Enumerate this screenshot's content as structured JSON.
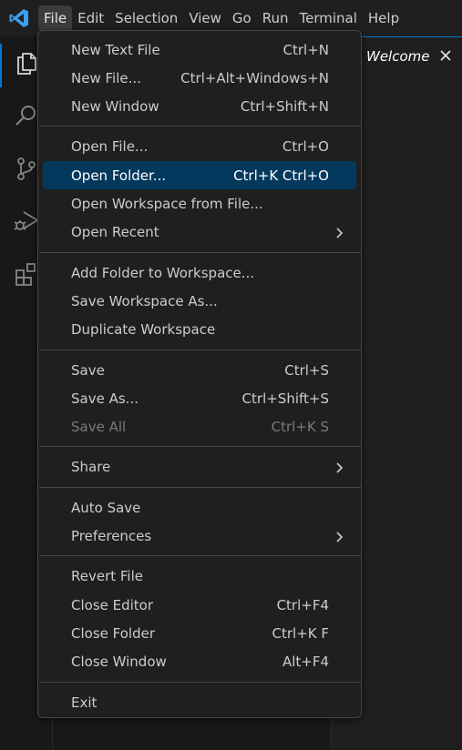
{
  "menubar": {
    "items": [
      {
        "label": "File",
        "active": true
      },
      {
        "label": "Edit"
      },
      {
        "label": "Selection"
      },
      {
        "label": "View"
      },
      {
        "label": "Go"
      },
      {
        "label": "Run"
      },
      {
        "label": "Terminal"
      },
      {
        "label": "Help"
      }
    ]
  },
  "activitybar": {
    "icons": [
      "explorer-icon",
      "search-icon",
      "source-control-icon",
      "run-debug-icon",
      "extensions-icon"
    ]
  },
  "editor": {
    "tab_label": "Welcome"
  },
  "file_menu": {
    "groups": [
      [
        {
          "label": "New Text File",
          "shortcut": "Ctrl+N"
        },
        {
          "label": "New File...",
          "shortcut": "Ctrl+Alt+Windows+N"
        },
        {
          "label": "New Window",
          "shortcut": "Ctrl+Shift+N"
        }
      ],
      [
        {
          "label": "Open File...",
          "shortcut": "Ctrl+O"
        },
        {
          "label": "Open Folder...",
          "shortcut": "Ctrl+K Ctrl+O",
          "highlight": true
        },
        {
          "label": "Open Workspace from File...",
          "shortcut": ""
        },
        {
          "label": "Open Recent",
          "shortcut": "",
          "submenu": true
        }
      ],
      [
        {
          "label": "Add Folder to Workspace...",
          "shortcut": ""
        },
        {
          "label": "Save Workspace As...",
          "shortcut": ""
        },
        {
          "label": "Duplicate Workspace",
          "shortcut": ""
        }
      ],
      [
        {
          "label": "Save",
          "shortcut": "Ctrl+S"
        },
        {
          "label": "Save As...",
          "shortcut": "Ctrl+Shift+S"
        },
        {
          "label": "Save All",
          "shortcut": "Ctrl+K S",
          "disabled": true
        }
      ],
      [
        {
          "label": "Share",
          "shortcut": "",
          "submenu": true
        }
      ],
      [
        {
          "label": "Auto Save",
          "shortcut": ""
        },
        {
          "label": "Preferences",
          "shortcut": "",
          "submenu": true
        }
      ],
      [
        {
          "label": "Revert File",
          "shortcut": ""
        },
        {
          "label": "Close Editor",
          "shortcut": "Ctrl+F4"
        },
        {
          "label": "Close Folder",
          "shortcut": "Ctrl+K F"
        },
        {
          "label": "Close Window",
          "shortcut": "Alt+F4"
        }
      ],
      [
        {
          "label": "Exit",
          "shortcut": ""
        }
      ]
    ]
  },
  "colors": {
    "accent": "#0078d4",
    "highlight": "#04395e",
    "logo": "#3aa1f0"
  }
}
